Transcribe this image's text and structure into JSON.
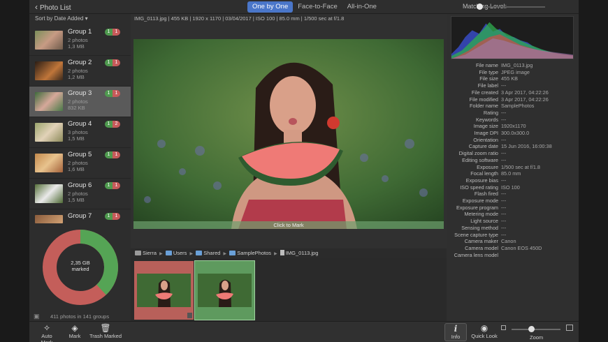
{
  "topbar": {
    "back_label": "Photo List",
    "segments": [
      "One by One",
      "Face-to-Face",
      "All-in-One"
    ],
    "active_segment": "One by One",
    "matching_label": "Matching Level:"
  },
  "sidebar": {
    "sort_label": "Sort by Date Added",
    "groups": [
      {
        "title": "Group 1",
        "photos": "2 photos",
        "size": "1,3 MB",
        "green": "1",
        "red": "1"
      },
      {
        "title": "Group 2",
        "photos": "2 photos",
        "size": "1,2 MB",
        "green": "1",
        "red": "1"
      },
      {
        "title": "Group 3",
        "photos": "2 photos",
        "size": "832 KB",
        "green": "1",
        "red": "1"
      },
      {
        "title": "Group 4",
        "photos": "3 photos",
        "size": "1,5 MB",
        "green": "1",
        "red": "2"
      },
      {
        "title": "Group 5",
        "photos": "2 photos",
        "size": "1,6 MB",
        "green": "1",
        "red": "1"
      },
      {
        "title": "Group 6",
        "photos": "2 photos",
        "size": "1,5 MB",
        "green": "1",
        "red": "1"
      },
      {
        "title": "Group 7",
        "photos": "",
        "size": "",
        "green": "1",
        "red": "1"
      }
    ],
    "donut": {
      "line1": "2,35 GB",
      "line2": "marked",
      "marked_fraction": 0.62
    },
    "footer": "411 photos in 141 groups"
  },
  "viewer": {
    "info": "IMG_0113.jpg  |  455 KB  |  1920 x 1170  |  03/04/2017  |  ISO 100  |  85.0 mm  |  1/500 sec at f/1.8",
    "mark_label": "Click to Mark",
    "path": [
      "Sierra",
      "Users",
      "Shared",
      "SamplePhotos",
      "IMG_0113.jpg"
    ]
  },
  "metadata": [
    {
      "k": "File name",
      "v": "IMG_0113.jpg"
    },
    {
      "k": "File type",
      "v": "JPEG image"
    },
    {
      "k": "File size",
      "v": "455 KB"
    },
    {
      "k": "File label",
      "v": "---"
    },
    {
      "k": "File created",
      "v": "3 Apr 2017, 04:22:26"
    },
    {
      "k": "File modified",
      "v": "3 Apr 2017, 04:22:26"
    },
    {
      "k": "Folder name",
      "v": "SamplePhotos"
    },
    {
      "k": "Rating",
      "v": "---"
    },
    {
      "k": "Keywords",
      "v": "---"
    },
    {
      "k": "Image size",
      "v": "1920x1170"
    },
    {
      "k": "Image DPI",
      "v": "300.0x300.0"
    },
    {
      "k": "Orientation",
      "v": "---"
    },
    {
      "k": "Capture date",
      "v": "15 Jun 2016, 16:00:38"
    },
    {
      "k": "Digital zoom ratio",
      "v": "---"
    },
    {
      "k": "Editing software",
      "v": "---"
    },
    {
      "k": "Exposure",
      "v": "1/500 sec at f/1.8"
    },
    {
      "k": "Focal length",
      "v": "85.0 mm"
    },
    {
      "k": "Exposure bias",
      "v": "---"
    },
    {
      "k": "ISO speed rating",
      "v": "ISO 100"
    },
    {
      "k": "Flash fired",
      "v": "---"
    },
    {
      "k": "Exposure mode",
      "v": "---"
    },
    {
      "k": "Exposure program",
      "v": "---"
    },
    {
      "k": "Metering mode",
      "v": "---"
    },
    {
      "k": "Light source",
      "v": "---"
    },
    {
      "k": "Sensing method",
      "v": "---"
    },
    {
      "k": "Scene capture type",
      "v": "---"
    },
    {
      "k": "Camera maker",
      "v": "Canon"
    },
    {
      "k": "Camera model",
      "v": "Canon EOS 450D"
    },
    {
      "k": "Camera lens model",
      "v": ""
    }
  ],
  "toolbar": {
    "auto_mark": "Auto Mark",
    "mark": "Mark",
    "trash_marked": "Trash Marked",
    "info": "Info",
    "quick_look": "Quick Look",
    "zoom": "Zoom"
  },
  "colors": {
    "accent": "#4a76c9",
    "keep": "#5e9a5e",
    "trash": "#b8605a"
  },
  "icons": [
    "chevron-left-icon",
    "wand-icon",
    "mark-icon",
    "trash-icon",
    "info-icon",
    "eye-icon",
    "folder-icon",
    "file-icon"
  ]
}
